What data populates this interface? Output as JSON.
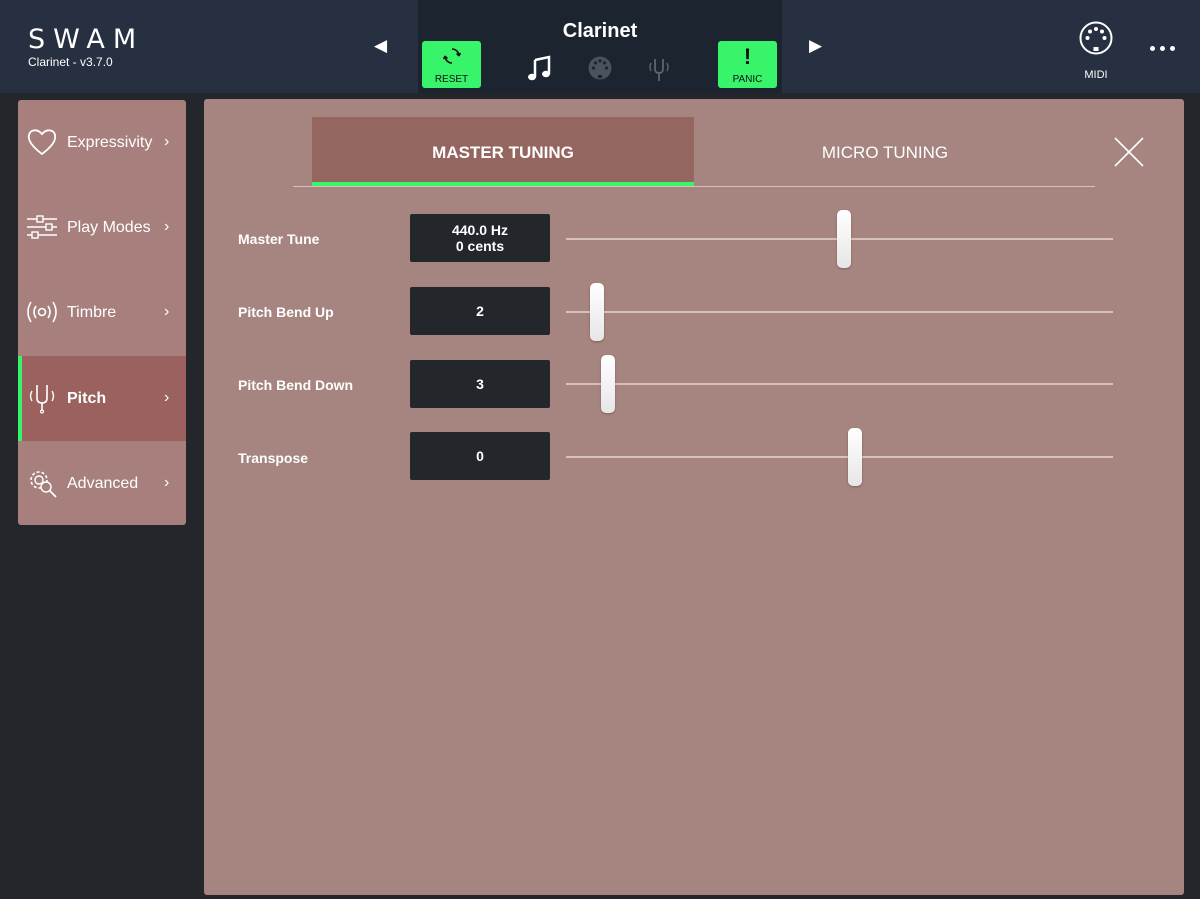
{
  "header": {
    "logo": "SWAM",
    "version": "Clarinet - v3.7.0",
    "instrument": "Clarinet",
    "reset_label": "RESET",
    "panic_label": "PANIC",
    "panic_glyph": "!",
    "midi_label": "MIDI",
    "prev_glyph": "◀",
    "next_glyph": "▶"
  },
  "sidebar": {
    "items": [
      {
        "label": "Expressivity",
        "icon": "heart-icon"
      },
      {
        "label": "Play Modes",
        "icon": "sliders-icon"
      },
      {
        "label": "Timbre",
        "icon": "waves-icon"
      },
      {
        "label": "Pitch",
        "icon": "tuning-fork-icon",
        "active": true
      },
      {
        "label": "Advanced",
        "icon": "gear-search-icon"
      }
    ],
    "chevron": "›"
  },
  "tabs": {
    "master": "MASTER TUNING",
    "micro": "MICRO TUNING",
    "active": "master"
  },
  "params": [
    {
      "label": "Master Tune",
      "value": "440.0 Hz",
      "value2": "0 cents",
      "level": 0.48
    },
    {
      "label": "Pitch Bend Up",
      "value": "2",
      "value2": "",
      "level": 0.03
    },
    {
      "label": "Pitch Bend Down",
      "value": "3",
      "value2": "",
      "level": 0.05
    },
    {
      "label": "Transpose",
      "value": "0",
      "value2": "",
      "level": 0.5
    }
  ],
  "colors": {
    "accent": "#37f46b",
    "header_bg": "#263040",
    "panel_bg": "#a6847f",
    "active_item": "#9a615e"
  }
}
